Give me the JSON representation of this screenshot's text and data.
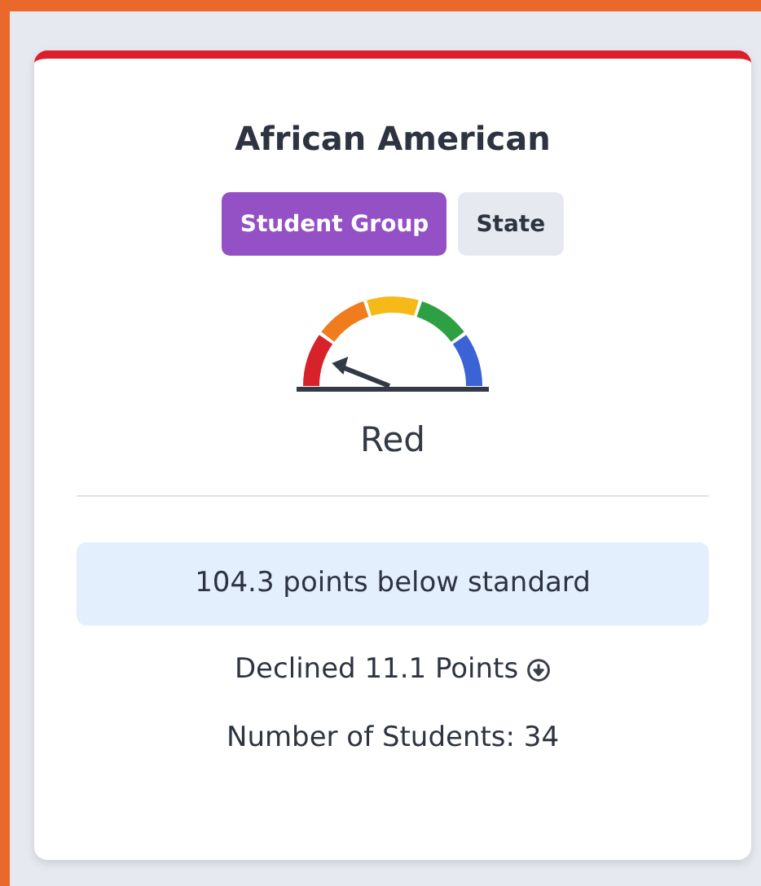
{
  "card": {
    "title": "African American",
    "tags": [
      {
        "label": "Student Group",
        "selected": true
      },
      {
        "label": "State",
        "selected": false
      }
    ],
    "status": "Red",
    "distance": "104.3 points below standard",
    "change": "Declined 11.1 Points",
    "students": "Number of Students: 34"
  }
}
